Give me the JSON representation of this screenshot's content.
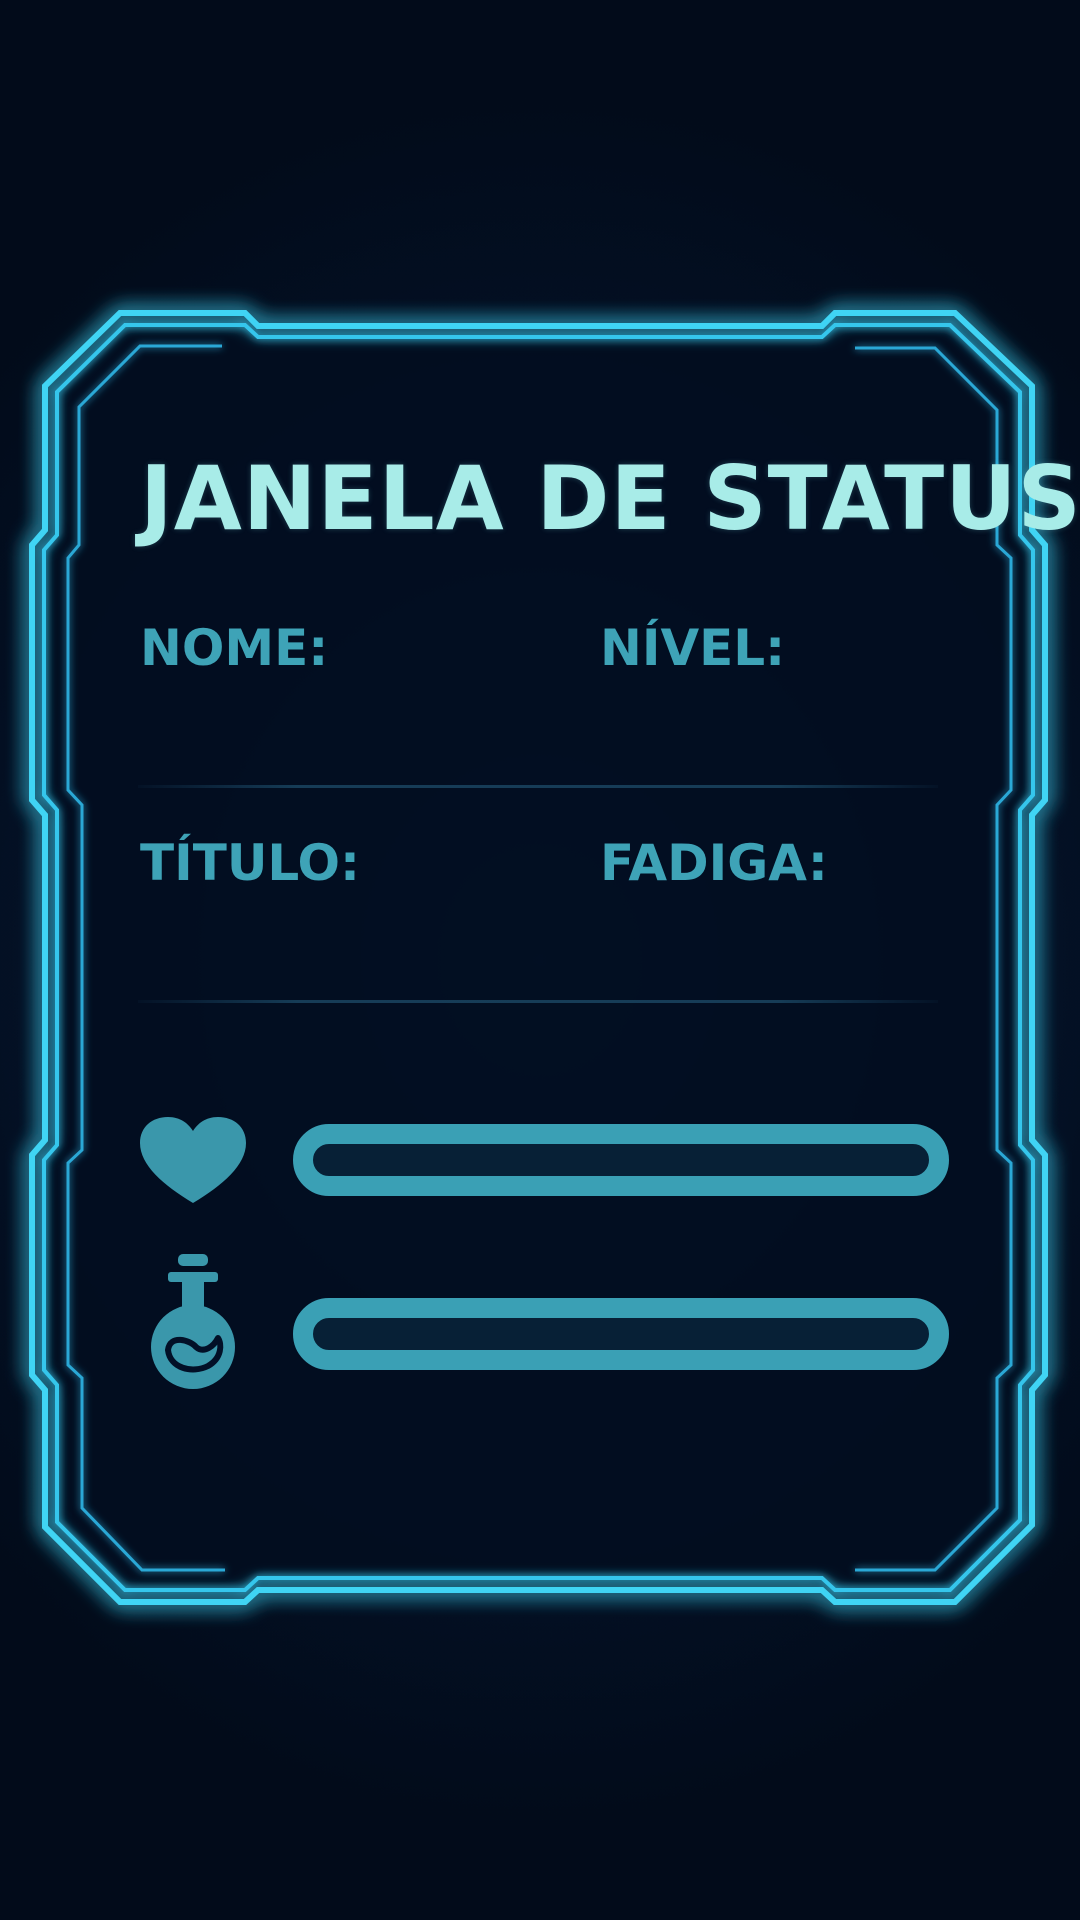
{
  "window": {
    "title": "JANELA DE STATUS"
  },
  "fields": {
    "name_label": "NOME:",
    "level_label": "NÍVEL:",
    "title_label": "TÍTULO:",
    "fatigue_label": "FADIGA:"
  },
  "stats": {
    "health": {
      "icon": "heart-icon",
      "fill_fraction": 0
    },
    "mana": {
      "icon": "potion-icon",
      "fill_fraction": 0
    }
  },
  "colors": {
    "frame_glow": "#3fd4f4",
    "title": "#a8ece8",
    "label": "#3ea3b7",
    "bar": "#3aa0b5",
    "background": "#020b1a"
  }
}
